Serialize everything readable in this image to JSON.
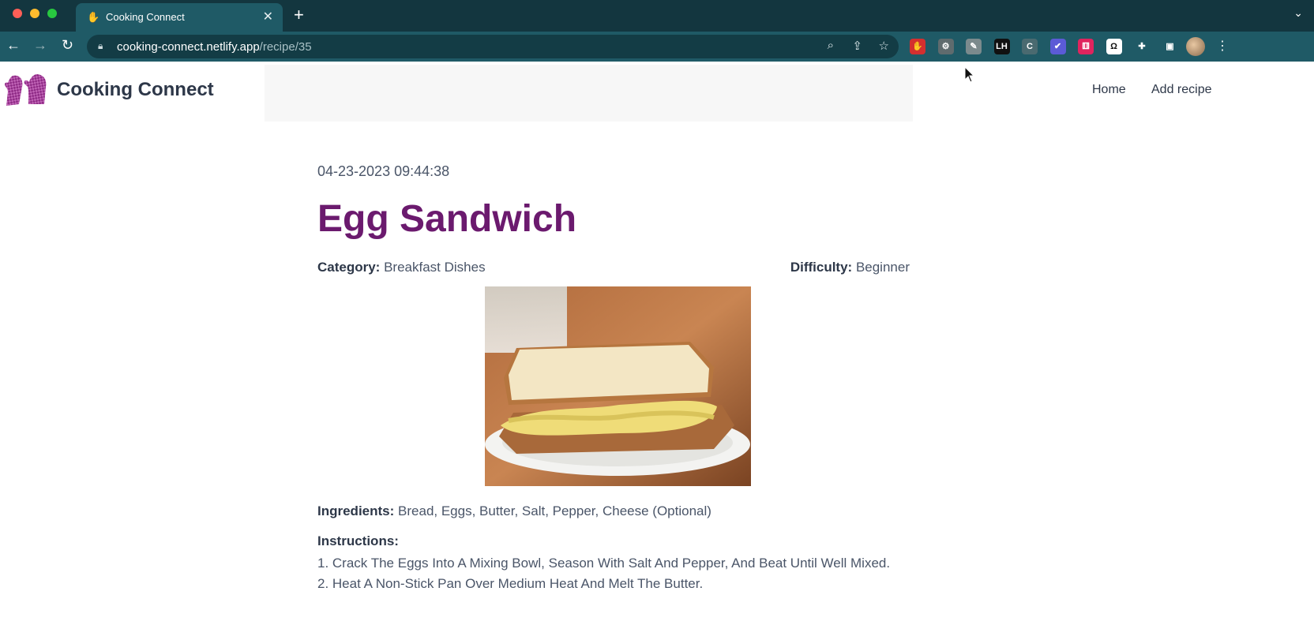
{
  "browser": {
    "tab_title": "Cooking Connect",
    "url_host": "cooking-connect.netlify.app",
    "url_path": "/recipe/35",
    "new_tab": "+",
    "tab_close": "✕",
    "extensions": [
      {
        "name": "adblock-extension-icon",
        "glyph": "✋",
        "color": "#d32f2f"
      },
      {
        "name": "settings-extension-icon",
        "glyph": "⚙",
        "color": "#5f6b6e"
      },
      {
        "name": "notes-extension-icon",
        "glyph": "✎",
        "color": "#7b8a8d"
      },
      {
        "name": "lh-extension-icon",
        "glyph": "LH",
        "color": "#111111"
      },
      {
        "name": "c-extension-icon",
        "glyph": "C",
        "color": "#4a6a70"
      },
      {
        "name": "check-extension-icon",
        "glyph": "✔",
        "color": "#5b5bd6"
      },
      {
        "name": "dice-extension-icon",
        "glyph": "⚅",
        "color": "#e0245e"
      },
      {
        "name": "omega-extension-icon",
        "glyph": "Ω",
        "color": "#ffffff"
      },
      {
        "name": "puzzle-extension-icon",
        "glyph": "✚",
        "color": "#1f5a66"
      },
      {
        "name": "sidepanel-extension-icon",
        "glyph": "▣",
        "color": "#1f5a66"
      }
    ]
  },
  "site": {
    "brand": "Cooking Connect",
    "nav": {
      "home": "Home",
      "add_recipe": "Add recipe"
    }
  },
  "recipe": {
    "timestamp": "04-23-2023 09:44:38",
    "title": "Egg Sandwich",
    "category_label": "Category:",
    "category": "Breakfast Dishes",
    "difficulty_label": "Difficulty:",
    "difficulty": "Beginner",
    "ingredients_label": "Ingredients:",
    "ingredients": "Bread, Eggs, Butter, Salt, Pepper, Cheese (Optional)",
    "instructions_label": "Instructions:",
    "steps": [
      "1. Crack The Eggs Into A Mixing Bowl, Season With Salt And Pepper, And Beat Until Well Mixed.",
      "2. Heat A Non-Stick Pan Over Medium Heat And Melt The Butter."
    ]
  },
  "colors": {
    "title": "#6b1a6e",
    "chrome_dark": "#13363f",
    "chrome": "#1f5a66"
  }
}
